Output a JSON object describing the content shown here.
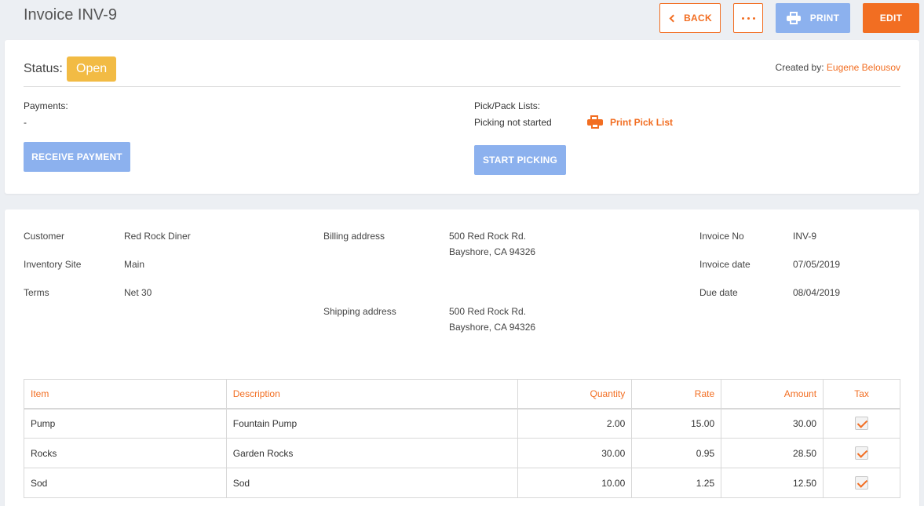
{
  "header": {
    "title": "Invoice INV-9",
    "back_label": "BACK",
    "print_label": "PRINT",
    "edit_label": "EDIT"
  },
  "status": {
    "label": "Status:",
    "value": "Open",
    "created_by_label": "Created by:",
    "created_by_user": "Eugene Belousov"
  },
  "payments": {
    "label": "Payments:",
    "value": "-",
    "button_label": "RECEIVE PAYMENT"
  },
  "picking": {
    "label": "Pick/Pack Lists:",
    "value": "Picking not started",
    "print_link": "Print Pick List",
    "button_label": "START PICKING"
  },
  "details": {
    "customer_label": "Customer",
    "customer": "Red Rock Diner",
    "site_label": "Inventory Site",
    "site": "Main",
    "terms_label": "Terms",
    "terms": "Net 30",
    "billing_label": "Billing address",
    "billing_line1": "500 Red Rock Rd.",
    "billing_line2": "Bayshore, CA 94326",
    "shipping_label": "Shipping address",
    "shipping_line1": "500 Red Rock Rd.",
    "shipping_line2": "Bayshore, CA 94326",
    "invoice_no_label": "Invoice No",
    "invoice_no": "INV-9",
    "invoice_date_label": "Invoice date",
    "invoice_date": "07/05/2019",
    "due_date_label": "Due date",
    "due_date": "08/04/2019"
  },
  "table": {
    "headers": {
      "item": "Item",
      "description": "Description",
      "quantity": "Quantity",
      "rate": "Rate",
      "amount": "Amount",
      "tax": "Tax"
    },
    "rows": [
      {
        "item": "Pump",
        "description": "Fountain Pump",
        "quantity": "2.00",
        "rate": "15.00",
        "amount": "30.00",
        "tax": true
      },
      {
        "item": "Rocks",
        "description": "Garden Rocks",
        "quantity": "30.00",
        "rate": "0.95",
        "amount": "28.50",
        "tax": true
      },
      {
        "item": "Sod",
        "description": "Sod",
        "quantity": "10.00",
        "rate": "1.25",
        "amount": "12.50",
        "tax": true
      }
    ]
  },
  "colors": {
    "accent": "#f26e22",
    "status_open": "#f2bb44",
    "button_disabled": "#8cb1ee"
  }
}
